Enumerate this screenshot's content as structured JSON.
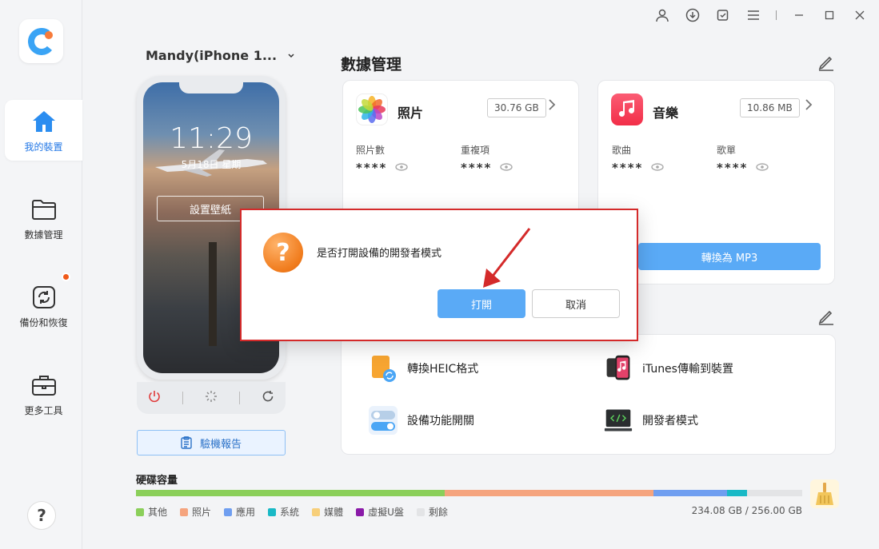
{
  "window": {
    "controls": [
      "user-icon",
      "download-icon",
      "feedback-icon",
      "menu-icon",
      "minimize-icon",
      "maximize-icon",
      "close-icon"
    ]
  },
  "sidebar": {
    "items": [
      {
        "label": "我的裝置",
        "icon": "home-icon",
        "active": true
      },
      {
        "label": "數據管理",
        "icon": "folder-icon",
        "active": false
      },
      {
        "label": "備份和恢復",
        "icon": "backup-icon",
        "active": false,
        "badge": true
      },
      {
        "label": "更多工具",
        "icon": "toolbox-icon",
        "active": false
      }
    ],
    "help_label": "?"
  },
  "device": {
    "name": "Mandy(iPhone 1...",
    "time": "11:29",
    "date": "5月18日 星期",
    "wallpaper_button": "設置壁紙",
    "report_button": "驗機報告"
  },
  "data_management": {
    "title": "數據管理",
    "photos": {
      "name": "照片",
      "size": "30.76 GB",
      "stats": [
        {
          "label": "照片數",
          "value": "****"
        },
        {
          "label": "重複項",
          "value": "****"
        }
      ]
    },
    "music": {
      "name": "音樂",
      "size": "10.86 MB",
      "stats": [
        {
          "label": "歌曲",
          "value": "****"
        },
        {
          "label": "歌單",
          "value": "****"
        }
      ],
      "convert_button": "轉換為 MP3"
    }
  },
  "tools": [
    {
      "label": "轉換HEIC格式",
      "icon": "heic-convert-icon"
    },
    {
      "label": "iTunes傳輸到裝置",
      "icon": "itunes-transfer-icon"
    },
    {
      "label": "設備功能開關",
      "icon": "toggle-icon"
    },
    {
      "label": "開發者模式",
      "icon": "developer-icon"
    }
  ],
  "storage": {
    "title": "硬碟容量",
    "total": "234.08 GB / 256.00 GB",
    "segments": [
      {
        "label": "其他",
        "color": "#8bcf5a",
        "fraction": 0.463
      },
      {
        "label": "照片",
        "color": "#f5a47e",
        "fraction": 0.313
      },
      {
        "label": "應用",
        "color": "#6f9ef0",
        "fraction": 0.111
      },
      {
        "label": "系統",
        "color": "#19b9c6",
        "fraction": 0.03
      },
      {
        "label": "媒體",
        "color": "#f7cf7a",
        "fraction": 0.0
      },
      {
        "label": "虛擬U盤",
        "color": "#8a1aa8",
        "fraction": 0.0
      },
      {
        "label": "剩餘",
        "color": "#e3e4e6",
        "fraction": 0.083
      }
    ]
  },
  "dialog": {
    "message": "是否打開設備的開發者模式",
    "ok_button": "打開",
    "cancel_button": "取消"
  }
}
